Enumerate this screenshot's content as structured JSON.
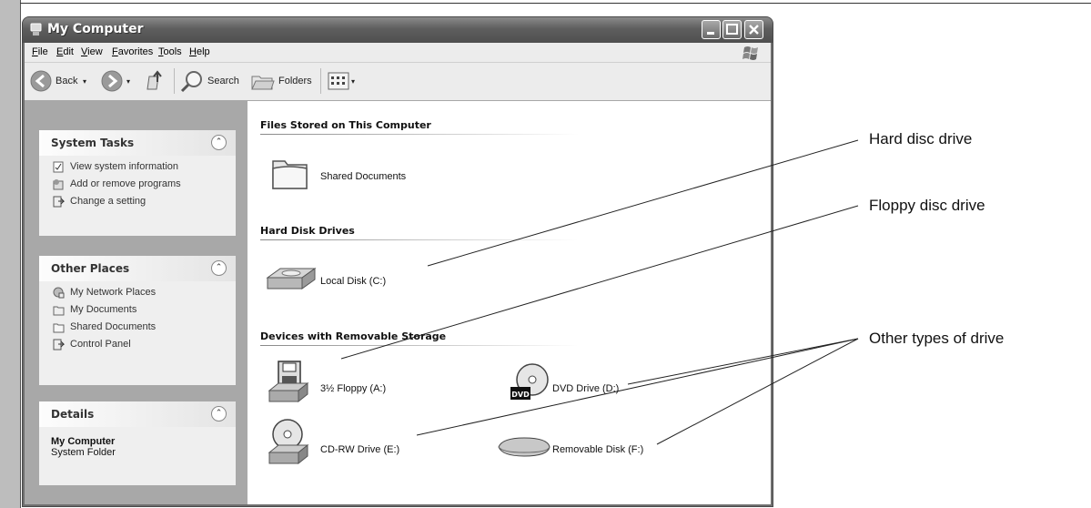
{
  "window": {
    "title": "My Computer"
  },
  "menu": [
    "File",
    "Edit",
    "View",
    "Favorites",
    "Tools",
    "Help"
  ],
  "toolbar": {
    "back": "Back",
    "search": "Search",
    "folders": "Folders"
  },
  "tasks": {
    "system": {
      "title": "System Tasks",
      "items": [
        "View system information",
        "Add or remove programs",
        "Change a setting"
      ]
    },
    "other": {
      "title": "Other Places",
      "items": [
        "My Network Places",
        "My Documents",
        "Shared Documents",
        "Control Panel"
      ]
    },
    "details": {
      "title": "Details",
      "name": "My Computer",
      "type": "System Folder"
    }
  },
  "groups": {
    "files": "Files Stored on This Computer",
    "hdd": "Hard Disk Drives",
    "removable": "Devices with Removable Storage"
  },
  "items": {
    "shared": "Shared Documents",
    "local_c": "Local Disk (C:)",
    "floppy": "3½ Floppy (A:)",
    "dvd": "DVD Drive (D:)",
    "cdrw": "CD-RW Drive (E:)",
    "removable": "Removable Disk (F:)",
    "dvd_badge": "DVD"
  },
  "callouts": {
    "hard": "Hard disc drive",
    "floppy": "Floppy disc drive",
    "other": "Other types of drive"
  }
}
